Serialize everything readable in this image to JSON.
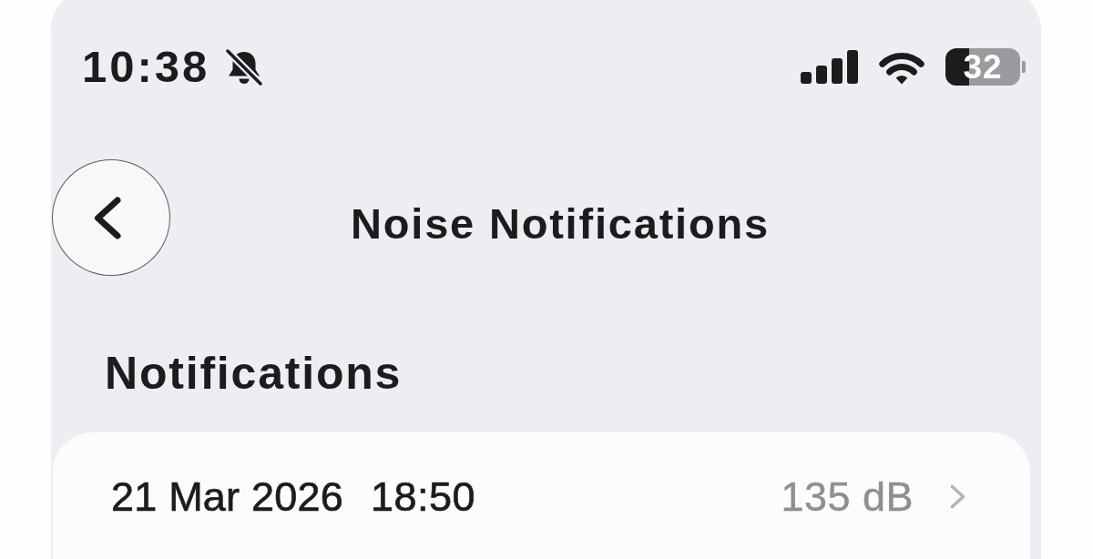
{
  "status_bar": {
    "time": "10:38",
    "silent": true,
    "battery": "32"
  },
  "nav": {
    "title": "Noise Notifications"
  },
  "section": {
    "title": "Notifications"
  },
  "notifications": [
    {
      "date": "21 Mar 2026",
      "time": "18:50",
      "reading": "135 dB"
    }
  ]
}
